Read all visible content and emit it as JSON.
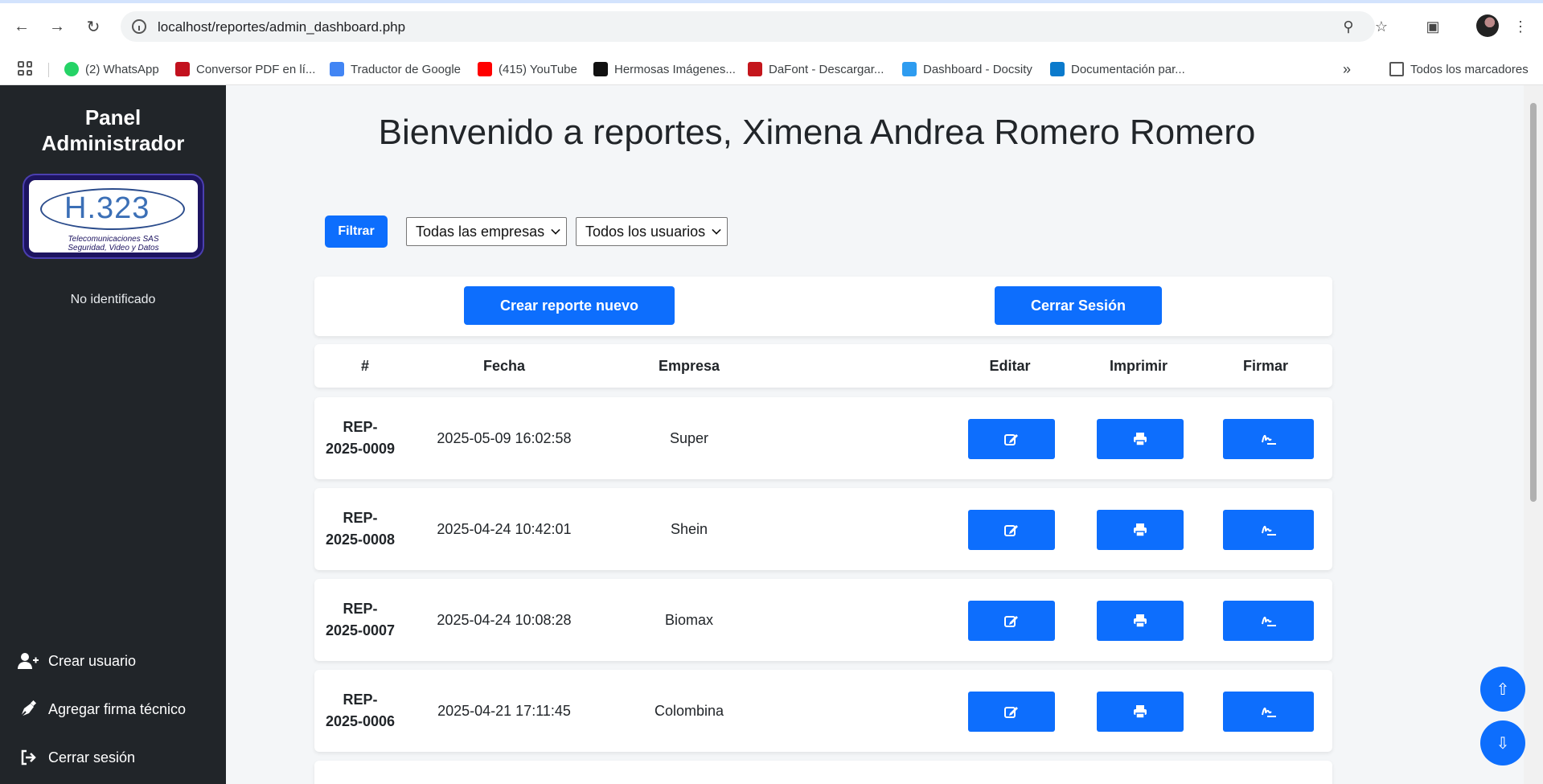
{
  "browser": {
    "url": "localhost/reportes/admin_dashboard.php",
    "bookmarks": [
      {
        "label": "(2) WhatsApp",
        "color": "#25d366"
      },
      {
        "label": "Conversor PDF en lí...",
        "color": "#c2111e"
      },
      {
        "label": "Traductor de Google",
        "color": "#4285f4"
      },
      {
        "label": "(415) YouTube",
        "color": "#ff0000"
      },
      {
        "label": "Hermosas Imágenes...",
        "color": "#111111"
      },
      {
        "label": "DaFont - Descargar...",
        "color": "#c4161c"
      },
      {
        "label": "Dashboard - Docsity",
        "color": "#2e9cf0"
      },
      {
        "label": "Documentación par...",
        "color": "#0a7acc"
      }
    ],
    "all_bookmarks": "Todos los marcadores"
  },
  "sidebar": {
    "title": "Panel Administrador",
    "logo": {
      "mark": "H.323",
      "line1": "Telecomunicaciones SAS",
      "line2": "Seguridad, Video y Datos"
    },
    "status": "No identificado",
    "links": [
      {
        "label": "Crear usuario",
        "icon": "user-plus-icon"
      },
      {
        "label": "Agregar firma técnico",
        "icon": "pen-nib-icon"
      },
      {
        "label": "Cerrar sesión",
        "icon": "sign-out-icon"
      }
    ]
  },
  "main": {
    "welcome": "Bienvenido a reportes, Ximena Andrea Romero Romero",
    "filter_button": "Filtrar",
    "company_select": "Todas las empresas",
    "user_select": "Todos los usuarios",
    "create_report": "Crear reporte nuevo",
    "logout": "Cerrar Sesión"
  },
  "table": {
    "headers": [
      "#",
      "Fecha",
      "Empresa",
      "Editar",
      "Imprimir",
      "Firmar"
    ],
    "rows": [
      {
        "id_line1": "REP-",
        "id_line2": "2025-0009",
        "fecha": "2025-05-09 16:02:58",
        "empresa": "Super"
      },
      {
        "id_line1": "REP-",
        "id_line2": "2025-0008",
        "fecha": "2025-04-24 10:42:01",
        "empresa": "Shein"
      },
      {
        "id_line1": "REP-",
        "id_line2": "2025-0007",
        "fecha": "2025-04-24 10:08:28",
        "empresa": "Biomax"
      },
      {
        "id_line1": "REP-",
        "id_line2": "2025-0006",
        "fecha": "2025-04-21 17:11:45",
        "empresa": "Colombina"
      }
    ]
  },
  "colors": {
    "primary": "#0d6efd",
    "sidebar": "#212529",
    "background": "#f4f6f8"
  }
}
